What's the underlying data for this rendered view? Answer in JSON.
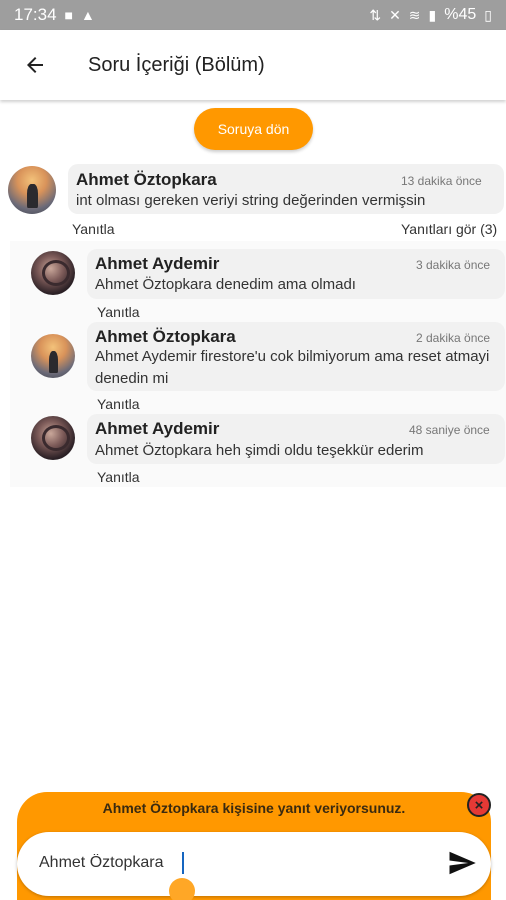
{
  "status_bar": {
    "time": "17:34",
    "battery": "%45"
  },
  "app_bar": {
    "title": "Soru İçeriği (Bölüm)"
  },
  "back_to_question_label": "Soruya dön",
  "main_comment": {
    "author": "Ahmet Öztopkara",
    "time": "13 dakika önce",
    "text": "int olması gereken veriyi string değerinden vermişsin",
    "reply_label": "Yanıtla",
    "view_replies_label": "Yanıtları gör (3)"
  },
  "replies": [
    {
      "author": "Ahmet Aydemir",
      "time": "3 dakika önce",
      "text": "Ahmet Öztopkara denedim ama olmadı",
      "reply_label": "Yanıtla"
    },
    {
      "author": "Ahmet Öztopkara",
      "time": "2 dakika önce",
      "text": "Ahmet Aydemir firestore'u cok bilmiyorum ama reset atmayi denedin mi",
      "reply_label": "Yanıtla"
    },
    {
      "author": "Ahmet Aydemir",
      "time": "48 saniye önce",
      "text": "Ahmet Öztopkara heh şimdi oldu teşekkür ederim",
      "reply_label": "Yanıtla"
    }
  ],
  "reply_bar": {
    "info_text": "Ahmet Öztopkara kişisine yanıt veriyorsunuz.",
    "close_label": "×",
    "input_value": "Ahmet Öztopkara"
  },
  "colors": {
    "accent": "#ff9800",
    "close": "#e53935"
  }
}
